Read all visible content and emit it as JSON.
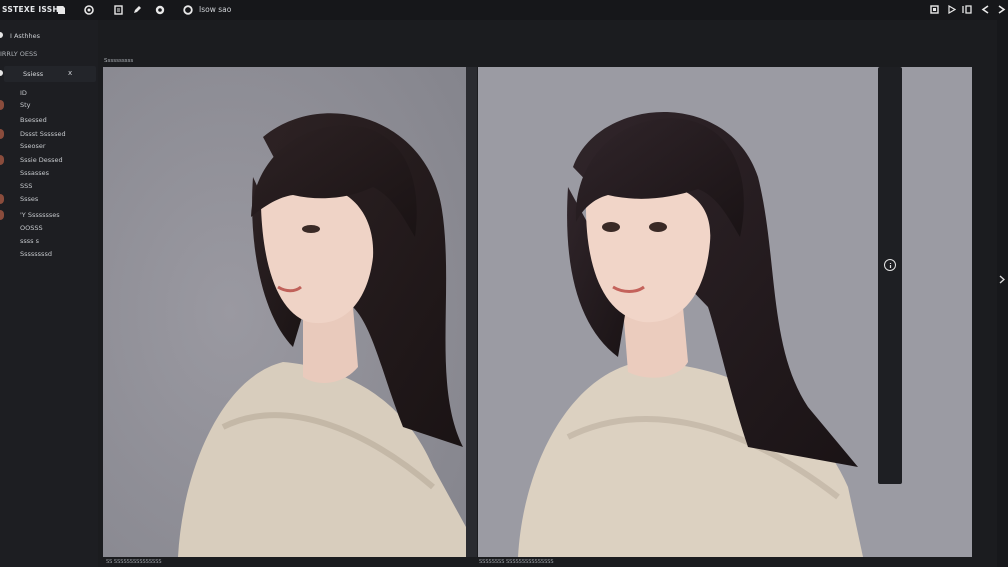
{
  "app": {
    "title": "SSTEXE ISSHE"
  },
  "toolbar": {
    "icons": [
      "doc-icon",
      "circle-icon",
      "page-icon",
      "pen-icon",
      "disc-icon",
      "settings-icon"
    ],
    "label": "Isow sao",
    "right_icons": [
      "stop-icon",
      "play-icon",
      "frame-icon",
      "back-icon",
      "forward-icon"
    ]
  },
  "sidebar": {
    "header": "I Asthhes",
    "sub": "IRRLY OESS",
    "section": {
      "label": "Ssiess",
      "close": "x"
    },
    "items": [
      {
        "label": "ID",
        "has_dot": false
      },
      {
        "label": "Sty",
        "has_dot": true
      },
      {
        "label": "Bsessed",
        "has_dot": false
      },
      {
        "label": "Dssst Sssssed",
        "has_dot": true
      },
      {
        "label": "Sseoser",
        "has_dot": false
      },
      {
        "label": "Sssie Dessed",
        "has_dot": true
      },
      {
        "label": "Sssasses",
        "has_dot": false
      },
      {
        "label": "SSS",
        "has_dot": false
      },
      {
        "label": "Ssses",
        "has_dot": true
      },
      {
        "label": "'Y Ssssssses",
        "has_dot": true
      },
      {
        "label": "OOSSS",
        "has_dot": false
      },
      {
        "label": "ssss s",
        "has_dot": false
      },
      {
        "label": "Ssssssssd",
        "has_dot": false
      }
    ]
  },
  "panels": {
    "left_caption": "Ssssssssss",
    "left_footer": "SS SSSSSSSSSSSSSSS",
    "right_footer": "SSSSSSSS SSSSSSSSSSSSSSS"
  },
  "colors": {
    "background": "#1b1c1f",
    "panel_bg": "#8f8f97",
    "accent": "#e6e6e6"
  }
}
